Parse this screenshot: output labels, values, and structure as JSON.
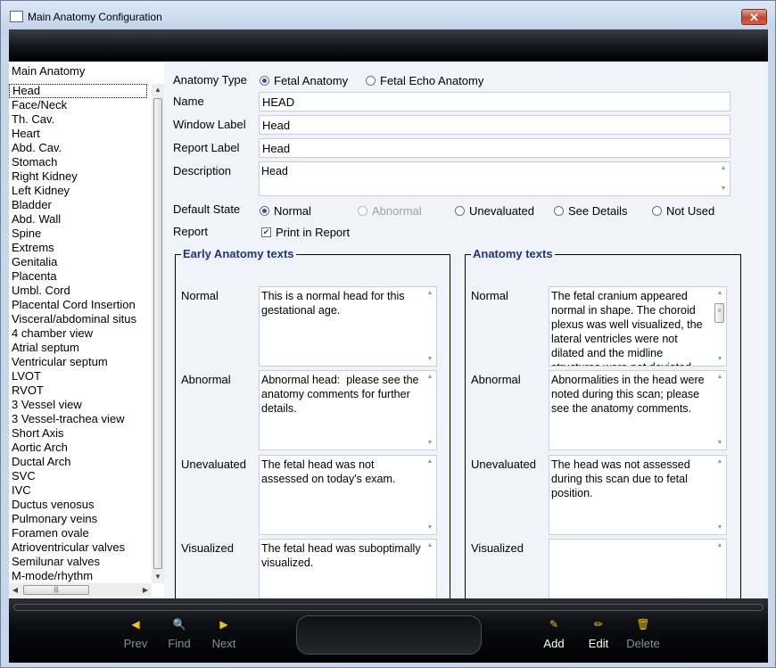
{
  "window": {
    "title": "Main Anatomy Configuration",
    "close_symbol": "✕"
  },
  "list": {
    "header": "Main Anatomy",
    "items": [
      "Head",
      "Face/Neck",
      "Th. Cav.",
      "Heart",
      "Abd. Cav.",
      "Stomach",
      "Right Kidney",
      "Left Kidney",
      "Bladder",
      "Abd. Wall",
      "Spine",
      "Extrems",
      "Genitalia",
      "Placenta",
      "Umbl. Cord",
      "Placental Cord Insertion",
      "Visceral/abdominal situs",
      "4 chamber view",
      "Atrial septum",
      "Ventricular septum",
      "LVOT",
      "RVOT",
      "3 Vessel view",
      "3 Vessel-trachea view",
      "Short Axis",
      "Aortic Arch",
      "Ductal Arch",
      "SVC",
      "IVC",
      "Ductus venosus",
      "Pulmonary veins",
      "Foramen ovale",
      "Atrioventricular valves",
      "Semilunar valves",
      "M-mode/rhythm"
    ],
    "selected_index": 0
  },
  "form": {
    "anatomy_type_label": "Anatomy Type",
    "anatomy_type_options": [
      "Fetal Anatomy",
      "Fetal Echo Anatomy"
    ],
    "anatomy_type_selected": "Fetal Anatomy",
    "name_label": "Name",
    "name_value": "HEAD",
    "window_label_label": "Window Label",
    "window_label_value": "Head",
    "report_label_label": "Report Label",
    "report_label_value": "Head",
    "description_label": "Description",
    "description_value": "Head",
    "default_state_label": "Default State",
    "default_state_options": [
      "Normal",
      "Abnormal",
      "Unevaluated",
      "See Details",
      "Not Used"
    ],
    "default_state_selected": "Normal",
    "report_label": "Report",
    "print_in_report_label": "Print in Report",
    "print_in_report_checked": true
  },
  "early_texts": {
    "title": "Early Anatomy texts",
    "normal_label": "Normal",
    "normal_text": "This is a normal head for this gestational age.",
    "abnormal_label": "Abnormal",
    "abnormal_text": "Abnormal head:  please see the anatomy comments for further details.",
    "unevaluated_label": "Unevaluated",
    "unevaluated_text": "The fetal head was not assessed on today's exam.",
    "visualized_label": "Visualized",
    "visualized_text": "The fetal head was suboptimally visualized."
  },
  "anatomy_texts": {
    "title": "Anatomy texts",
    "normal_label": "Normal",
    "normal_text": "The fetal cranium appeared normal in shape. The choroid plexus was well visualized, the lateral ventricles were not dilated and the midline structures were not deviated.",
    "abnormal_label": "Abnormal",
    "abnormal_text": "Abnormalities in the head were noted during this scan; please see the anatomy comments.",
    "unevaluated_label": "Unevaluated",
    "unevaluated_text": "The head was not assessed during this scan due to fetal position.",
    "visualized_label": "Visualized",
    "visualized_text": ""
  },
  "toolbar": {
    "prev": "Prev",
    "find": "Find",
    "next": "Next",
    "add": "Add",
    "edit": "Edit",
    "delete": "Delete"
  },
  "colors": {
    "accent_title": "#1f3479",
    "toolbar_icon": "#f1c40f"
  }
}
